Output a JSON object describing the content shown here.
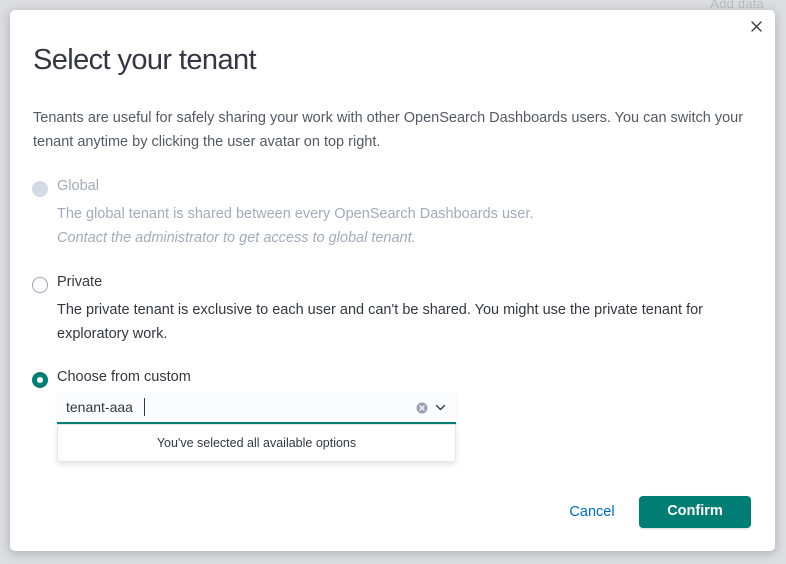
{
  "background": {
    "hint_text": "Add data"
  },
  "modal": {
    "title": "Select your tenant",
    "description": "Tenants are useful for safely sharing your work with other OpenSearch Dashboards users. You can switch your tenant anytime by clicking the user avatar on top right.",
    "close_icon": "close-icon"
  },
  "options": {
    "global": {
      "label": "Global",
      "help": "The global tenant is shared between every OpenSearch Dashboards user.",
      "note": "Contact the administrator to get access to global tenant.",
      "state": "disabled"
    },
    "private": {
      "label": "Private",
      "help_line1": "The private tenant is exclusive to each user and can't be shared. You might use the private tenant for",
      "help_line2": "exploratory work.",
      "state": "unchecked"
    },
    "custom": {
      "label": "Choose from custom",
      "state": "checked"
    }
  },
  "combo": {
    "value": "tenant-aaa",
    "clear_icon": "clear-icon",
    "chevron_icon": "chevron-down-icon",
    "dropdown_message": "You've selected all available options"
  },
  "footer": {
    "cancel_label": "Cancel",
    "confirm_label": "Confirm"
  },
  "colors": {
    "accent": "#017d73",
    "link": "#006bb4",
    "text": "#343741",
    "subdued": "#98a2b3"
  }
}
